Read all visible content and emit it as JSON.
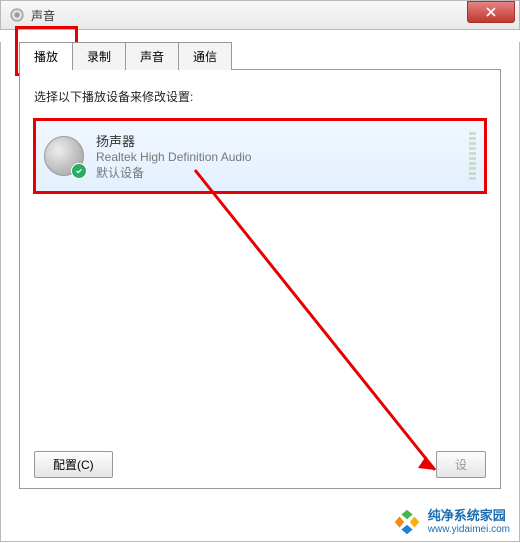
{
  "window": {
    "title": "声音"
  },
  "tabs": [
    {
      "label": "播放",
      "active": true
    },
    {
      "label": "录制",
      "active": false
    },
    {
      "label": "声音",
      "active": false
    },
    {
      "label": "通信",
      "active": false
    }
  ],
  "instruction": "选择以下播放设备来修改设置:",
  "devices": [
    {
      "name": "扬声器",
      "sub": "Realtek High Definition Audio",
      "status": "默认设备",
      "default": true
    }
  ],
  "buttons": {
    "configure": "配置(C)",
    "set_partial": "设"
  },
  "watermark": {
    "title": "纯净系统家园",
    "url": "www.yidaimei.com"
  },
  "colors": {
    "highlight": "#e60000"
  }
}
